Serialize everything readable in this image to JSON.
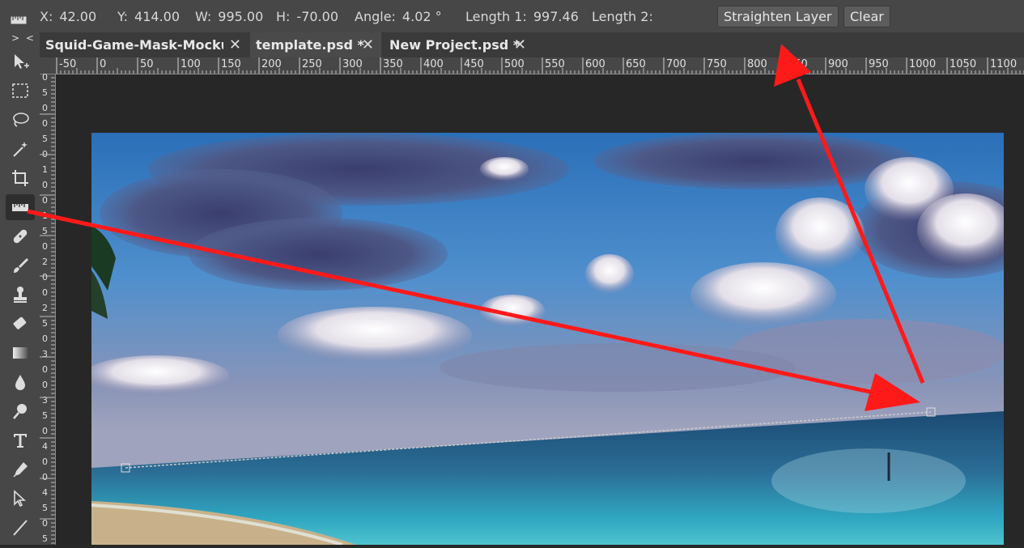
{
  "options_bar": {
    "tool_icon": "ruler-icon",
    "x_label": "X:",
    "x_value": "42.00",
    "y_label": "Y:",
    "y_value": "414.00",
    "w_label": "W:",
    "w_value": "995.00",
    "h_label": "H:",
    "h_value": "-70.00",
    "angle_label": "Angle:",
    "angle_value": "4.02 °",
    "length1_label": "Length 1:",
    "length1_value": "997.46",
    "length2_label": "Length 2:",
    "straighten_label": "Straighten Layer",
    "clear_label": "Clear"
  },
  "toolbar": {
    "collapse_label": "> <",
    "tools": [
      "move-tool",
      "marquee-tool",
      "lasso-tool",
      "magic-wand-tool",
      "crop-tool",
      "ruler-tool",
      "healing-tool",
      "brush-tool",
      "stamp-tool",
      "eraser-tool",
      "gradient-tool",
      "blur-tool",
      "dodge-tool",
      "type-tool",
      "pen-tool",
      "path-select-tool",
      "line-tool"
    ],
    "active_tool": "ruler-tool"
  },
  "tabs": [
    {
      "label": "Squid-Game-Mask-Mockup",
      "close": "✕"
    },
    {
      "label": "template.psd *",
      "close": "✕"
    },
    {
      "label": "New Project.psd *",
      "close": "✕"
    }
  ],
  "ruler": {
    "h_labels": [
      "-50",
      "0",
      "50",
      "100",
      "150",
      "200",
      "250",
      "300",
      "350",
      "400",
      "450",
      "500",
      "550",
      "600",
      "650",
      "700",
      "750",
      "800",
      "850",
      "900",
      "950",
      "1000",
      "1050",
      "1100"
    ],
    "v_digits": [
      "0",
      "5",
      "0",
      "0",
      "5",
      "0",
      "1",
      "0",
      "0",
      "1",
      "5",
      "0",
      "2",
      "0",
      "0",
      "2",
      "5",
      "0",
      "3",
      "0",
      "0",
      "3",
      "5",
      "0",
      "4",
      "0",
      "0",
      "4",
      "5",
      "0",
      "5"
    ]
  },
  "colors": {
    "annotation_arrow": "#ff1a1a",
    "panel": "#474747",
    "workspace": "#282828"
  }
}
